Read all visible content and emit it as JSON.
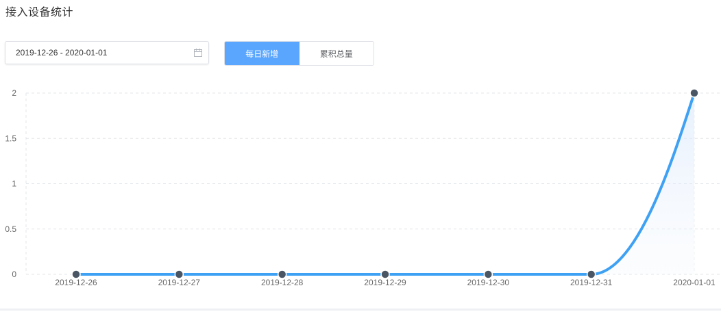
{
  "page": {
    "title": "接入设备统计"
  },
  "date_range": {
    "value": "2019-12-26 - 2020-01-01",
    "icon": "calendar-icon"
  },
  "toggle": {
    "options": [
      {
        "label": "每日新增",
        "active": true
      },
      {
        "label": "累积总量",
        "active": false
      }
    ],
    "active_color": "#5aa6ff"
  },
  "chart_data": {
    "type": "line",
    "title": "",
    "xlabel": "",
    "ylabel": "",
    "categories": [
      "2019-12-26",
      "2019-12-27",
      "2019-12-28",
      "2019-12-29",
      "2019-12-30",
      "2019-12-31",
      "2020-01-01"
    ],
    "series": [
      {
        "values": [
          0,
          0,
          0,
          0,
          0,
          0,
          2
        ],
        "color": "#3fa1f3",
        "marker_color": "#4a5663",
        "smooth": true,
        "area_fill": true
      }
    ],
    "ylim": [
      0,
      2
    ],
    "yticks": [
      0,
      0.5,
      1,
      1.5,
      2
    ],
    "ytick_labels": [
      "0",
      "0.5",
      "1",
      "1.5",
      "2"
    ],
    "grid": true
  }
}
